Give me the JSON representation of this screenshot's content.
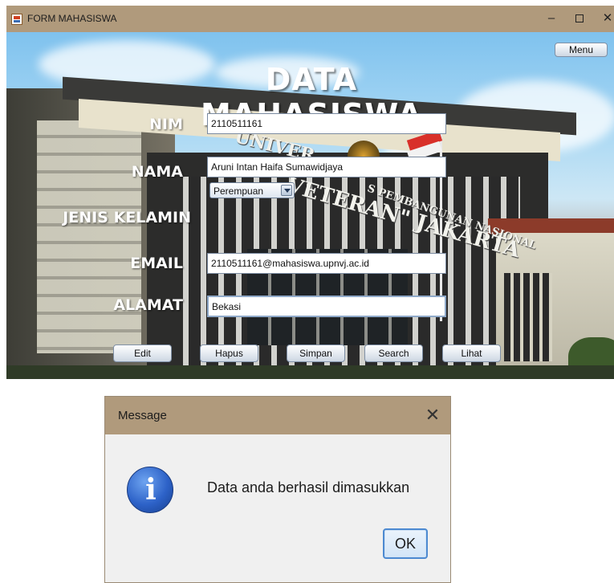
{
  "window": {
    "title": "FORM MAHASISWA",
    "minimize_glyph": "–",
    "close_glyph": "✕",
    "menu_button": "Menu"
  },
  "scene": {
    "sign_words": [
      "UNIVER",
      "S PEMBANGUNAN NASIONAL",
      "VETERAN\" JAKARTA"
    ]
  },
  "form": {
    "heading": "DATA MAHASISWA",
    "nim_label": "NIM",
    "nim_value": "2110511161",
    "nama_label": "NAMA",
    "nama_value": "Aruni Intan Haifa Sumawidjaya",
    "jenis_kelamin_label": "JENIS KELAMIN",
    "jenis_kelamin_value": "Perempuan",
    "email_label": "EMAIL",
    "email_value": "2110511161@mahasiswa.upnvj.ac.id",
    "alamat_label": "ALAMAT",
    "alamat_value": "Bekasi"
  },
  "buttons": {
    "edit": "Edit",
    "hapus": "Hapus",
    "simpan": "Simpan",
    "search": "Search",
    "lihat": "Lihat"
  },
  "dialog": {
    "title": "Message",
    "close_glyph": "✕",
    "icon_glyph": "i",
    "message": "Data anda berhasil dimasukkan",
    "ok": "OK"
  },
  "colors": {
    "titlebar": "#b09a7c",
    "dialog_bg": "#f0f0f0",
    "info_icon": "#2d62c8",
    "ok_border": "#4d8ad1"
  },
  "icons": [
    "app-icon",
    "minimize-icon",
    "maximize-icon",
    "close-icon",
    "info-icon",
    "dialog-close-icon"
  ]
}
